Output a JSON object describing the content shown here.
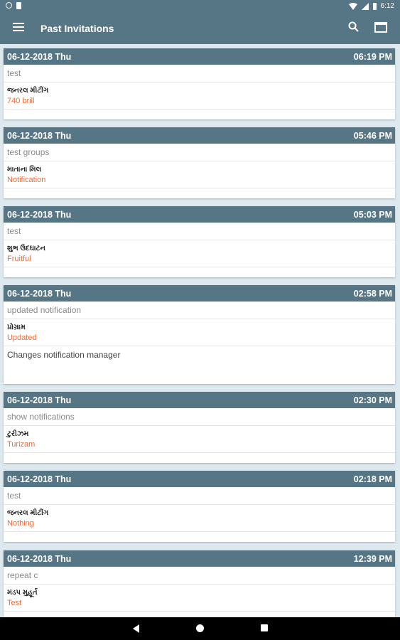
{
  "status_bar": {
    "time": "6:12"
  },
  "app_bar": {
    "title": "Past Invitations"
  },
  "invitations": [
    {
      "date": "06-12-2018 Thu",
      "time": "06:19 PM",
      "topic": "test",
      "gujarati": "જનરલ મીટીંગ",
      "category": "740 brill",
      "description": ""
    },
    {
      "date": "06-12-2018 Thu",
      "time": "05:46 PM",
      "topic": "test groups",
      "gujarati": "માતાના મિલ",
      "category": "Notification",
      "description": ""
    },
    {
      "date": "06-12-2018 Thu",
      "time": "05:03 PM",
      "topic": "test",
      "gujarati": "શુભ ઉદઘાટન",
      "category": "Fruitful",
      "description": ""
    },
    {
      "date": "06-12-2018 Thu",
      "time": "02:58 PM",
      "topic": "updated notification",
      "gujarati": "પ્રોગ્રામ",
      "category": "Updated",
      "description": "Changes notification manager"
    },
    {
      "date": "06-12-2018 Thu",
      "time": "02:30 PM",
      "topic": "show notifications",
      "gujarati": "ટુરીઝમ",
      "category": "Turizam",
      "description": ""
    },
    {
      "date": "06-12-2018 Thu",
      "time": "02:18 PM",
      "topic": "test",
      "gujarati": "જનરલ મીટીંગ",
      "category": "Nothing",
      "description": ""
    },
    {
      "date": "06-12-2018 Thu",
      "time": "12:39 PM",
      "topic": "repeat c",
      "gujarati": "મંડપ મુહૂર્ત",
      "category": "Test",
      "description": ""
    }
  ],
  "colors": {
    "primary": "#567585",
    "accent": "#f06b3a",
    "background": "#dde9ee"
  }
}
